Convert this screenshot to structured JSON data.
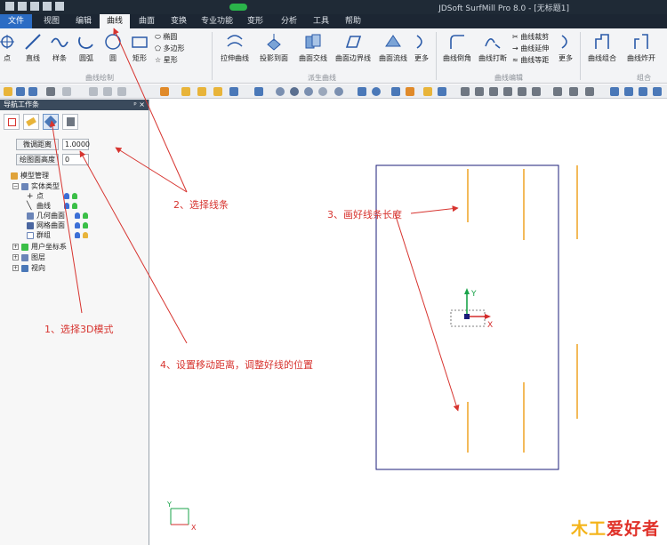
{
  "app": {
    "title": "JDSoft SurfMill Pro 8.0 - [无标题1]"
  },
  "menu": {
    "file": "文件",
    "tabs": [
      "视图",
      "编辑",
      "曲线",
      "曲面",
      "变换",
      "专业功能",
      "变形",
      "分析",
      "工具",
      "帮助"
    ],
    "active_tab": "曲线"
  },
  "ribbon": {
    "draw_group": {
      "label": "曲线绘制",
      "items": [
        "点",
        "直线",
        "样条",
        "圆弧",
        "圆",
        "矩形"
      ],
      "small_items": [
        "椭圆",
        "多边形",
        "星形"
      ]
    },
    "derive_group": {
      "label": "派生曲线",
      "items": [
        "拉伸曲线",
        "投影到面",
        "曲面交线",
        "曲面边界线",
        "曲面流线",
        "更多"
      ]
    },
    "edit_group": {
      "label": "曲线编辑",
      "items": [
        "曲线倒角",
        "曲线打断",
        "更多"
      ],
      "small_items": [
        "曲线裁剪",
        "曲线延伸",
        "曲线等距"
      ]
    },
    "combine_group": {
      "label": "组合",
      "items": [
        "曲线组合",
        "曲线炸开"
      ]
    }
  },
  "panel": {
    "title": "导航工作条",
    "pin": "ᵖ ×",
    "fields": [
      {
        "label": "微调距离",
        "value": "1.0000"
      },
      {
        "label": "绘图面高度",
        "value": "0"
      }
    ],
    "tree": {
      "root": "模型管理",
      "entity_types": "实体类型",
      "children": [
        "点",
        "曲线",
        "几何曲面",
        "网格曲面",
        "群组"
      ],
      "others": [
        "用户坐标系",
        "图层",
        "视向"
      ]
    }
  },
  "annotations": {
    "a1": "1、选择3D模式",
    "a2": "2、选择线条",
    "a3": "3、画好线条长度",
    "a4": "4、设置移动距离，调整好线的位置"
  },
  "axes": {
    "y": "Y",
    "x": "X"
  },
  "logo": {
    "text_a": "木工",
    "text_b": "爱好者"
  },
  "colors": {
    "annotation_red": "#d7342f",
    "guide_line": "#f0a830",
    "sheet_border": "#1b1d7a",
    "axis_green": "#1aa34a",
    "axis_red": "#d42b2b",
    "accent_blue": "#2b6cc4"
  }
}
